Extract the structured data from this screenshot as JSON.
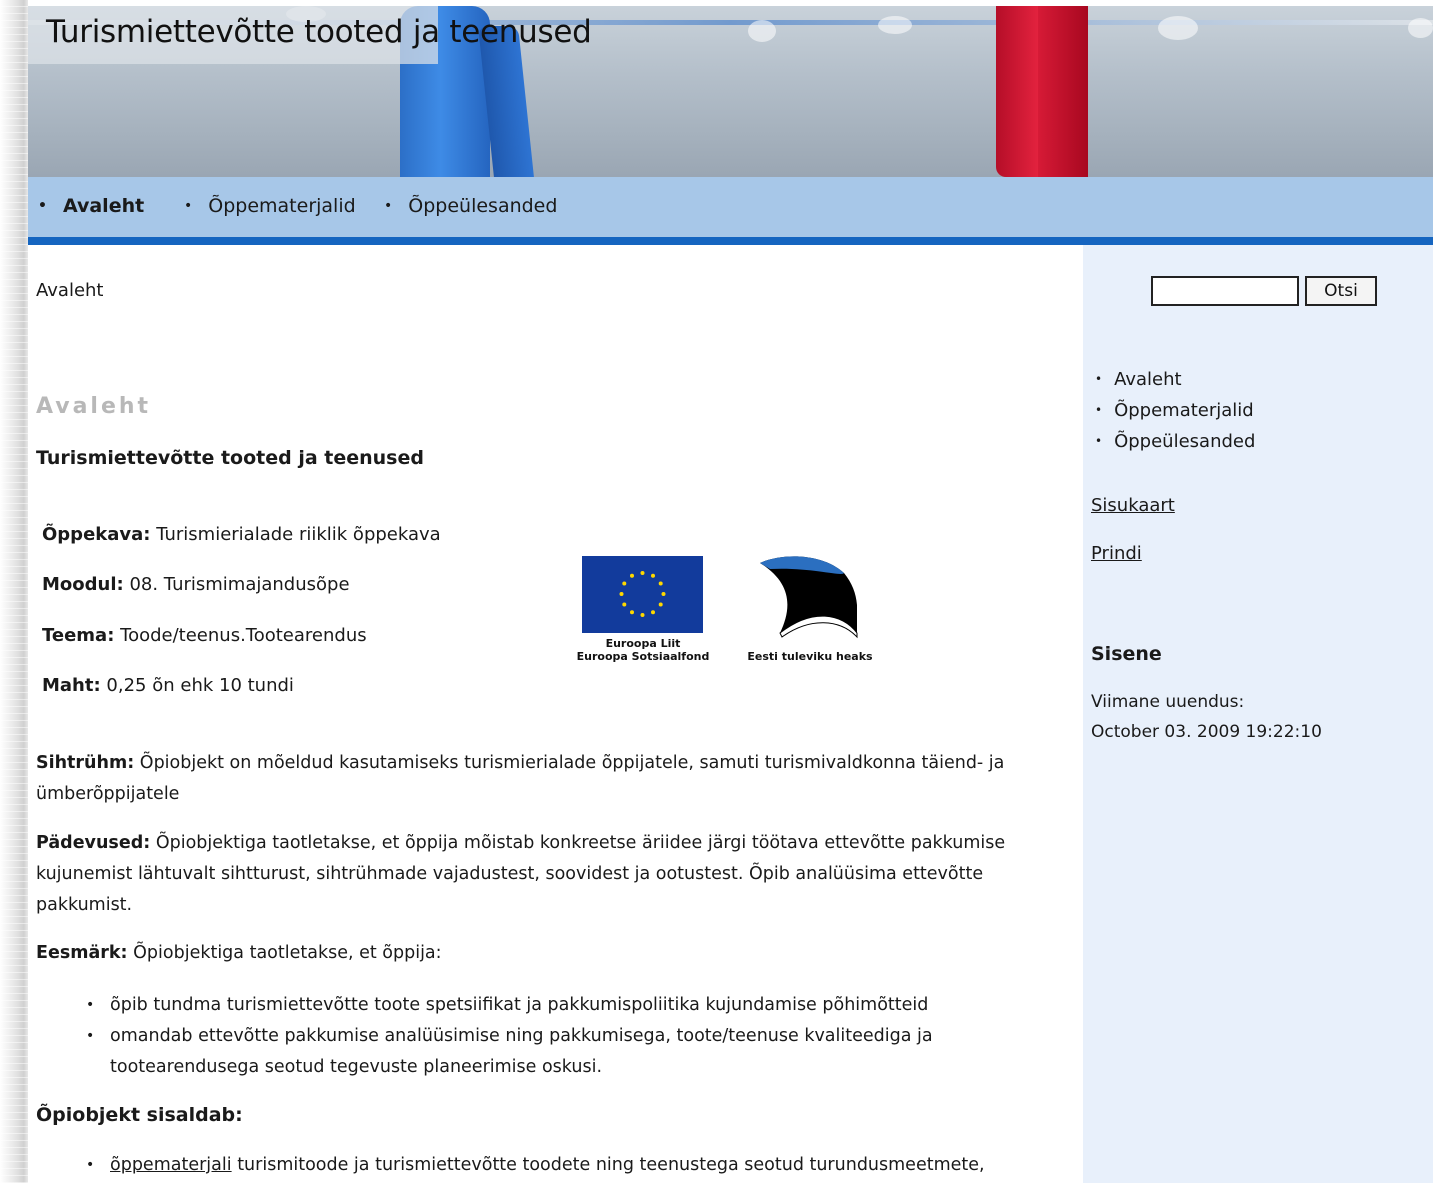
{
  "site": {
    "title": "Turismiettevõtte tooted ja teenused"
  },
  "nav": {
    "items": [
      {
        "label": "Avaleht"
      },
      {
        "label": "Õppematerjalid"
      },
      {
        "label": "Õppeülesanded"
      }
    ]
  },
  "search": {
    "value": "",
    "button_label": "Otsi"
  },
  "sidebar": {
    "nav": [
      "Avaleht",
      "Õppematerjalid",
      "Õppeülesanded"
    ],
    "sitemap_label": "Sisukaart",
    "print_label": "Prindi",
    "login_heading": "Sisene",
    "last_update_label": "Viimane uuendus:",
    "last_update_value": "October 03. 2009 19:22:10"
  },
  "main": {
    "breadcrumb": "Avaleht",
    "page_heading": "Avaleht",
    "subtitle": "Turismiettevõtte tooted ja teenused",
    "meta": {
      "curriculum_label": "Õppekava:",
      "curriculum_value": "Turismierialade riiklik õppekava",
      "module_label": "Moodul:",
      "module_value": "08. Turismimajandusõpe",
      "topic_label": "Teema:",
      "topic_value": "Toode/teenus.Tootearendus",
      "volume_label": "Maht:",
      "volume_value": "0,25 õn ehk 10 tundi"
    },
    "logos": {
      "eu_line1": "Euroopa Liit",
      "eu_line2": "Euroopa Sotsiaalfond",
      "ee_caption": "Eesti tuleviku heaks"
    },
    "target_label": "Sihtrühm:",
    "target_text": "Õpiobjekt on mõeldud kasutamiseks turismierialade õppijatele, samuti turismivaldkonna täiend- ja ümberõppijatele",
    "competence_label": "Pädevused:",
    "competence_text": "Õpiobjektiga taotletakse, et õppija mõistab konkreetse äriidee järgi töötava ettevõtte pakkumise kujunemist lähtuvalt sihtturust, sihtrühmade vajadustest, soovidest ja ootustest. Õpib analüüsima ettevõtte pakkumist.",
    "goal_label": "Eesmärk:",
    "goal_text": "Õpiobjektiga taotletakse, et õppija:",
    "goal_items": [
      "õpib tundma turismiettevõtte toote spetsiifikat ja pakkumispoliitika kujundamise põhimõtteid",
      "omandab ettevõtte pakkumise analüüsimise ning pakkumisega, toote/teenuse kvaliteediga ja tootearendusega seotud tegevuste planeerimise oskusi."
    ],
    "contains_heading": "Õpiobjekt sisaldab:",
    "contains_link": "õppematerjali",
    "contains_text": "turismitoode ja turismiettevõtte toodete ning teenustega seotud turundusmeetmete,"
  },
  "colors": {
    "nav_bg": "#a7c7e8",
    "nav_rule": "#1565c0",
    "sidebar_bg": "#e8f0fb",
    "heading_gray": "#b8b8b8"
  }
}
